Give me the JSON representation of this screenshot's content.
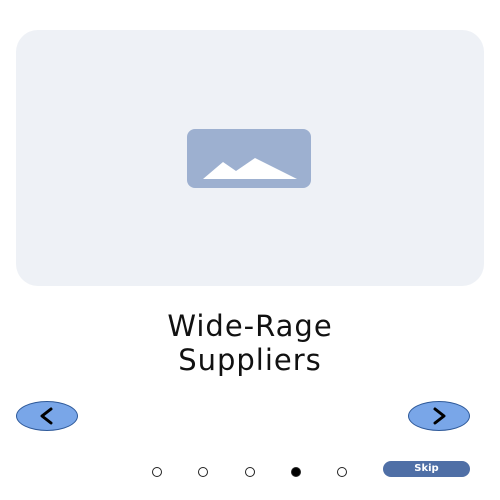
{
  "onboarding": {
    "title_line1": "Wide-Rage",
    "title_line2": "Suppliers",
    "image_icon": "image-placeholder-icon",
    "prev_icon": "chevron-left-icon",
    "next_icon": "chevron-right-icon",
    "skip_label": "Skip",
    "pagination": {
      "total": 5,
      "current": 4
    }
  },
  "colors": {
    "hero_bg": "#eef1f6",
    "placeholder_icon": "#9db0d0",
    "nav_button": "#79a6e8",
    "skip_button": "#4f6fa6"
  }
}
